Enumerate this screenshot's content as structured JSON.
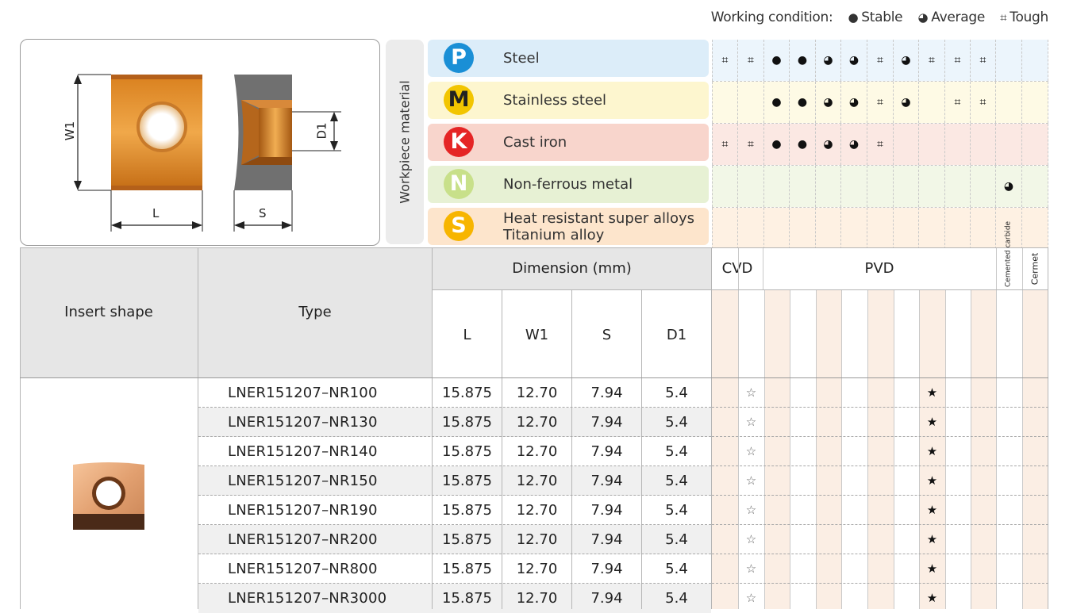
{
  "legend": {
    "label": "Working condition:",
    "items": [
      {
        "symbol": "●",
        "label": "Stable"
      },
      {
        "symbol": "◕",
        "label": "Average"
      },
      {
        "symbol": "⌗",
        "label": "Tough"
      }
    ]
  },
  "drawing": {
    "w1_label": "W1",
    "l_label": "L",
    "s_label": "S",
    "d1_label": "D1"
  },
  "workpiece_label": "Workpiece material",
  "materials": [
    {
      "letter": "P",
      "name": "Steel",
      "circle_color": "#1a8fd6",
      "bg": "#dcedf9",
      "conditions": [
        "⌗",
        "⌗",
        "●",
        "●",
        "◕",
        "◕",
        "⌗",
        "◕",
        "⌗",
        "⌗",
        "⌗",
        "",
        ""
      ]
    },
    {
      "letter": "M",
      "name": "Stainless steel",
      "circle_color": "#f2c500",
      "bg": "#fdf6cf",
      "conditions": [
        "",
        "",
        "●",
        "●",
        "◕",
        "◕",
        "⌗",
        "◕",
        "",
        "⌗",
        "⌗",
        "",
        ""
      ]
    },
    {
      "letter": "K",
      "name": "Cast iron",
      "circle_color": "#e52525",
      "bg": "#f8d5cc",
      "conditions": [
        "⌗",
        "⌗",
        "●",
        "●",
        "◕",
        "◕",
        "⌗",
        "",
        "",
        "",
        "",
        "",
        ""
      ]
    },
    {
      "letter": "N",
      "name": "Non-ferrous metal",
      "circle_color": "#c8e08a",
      "bg": "#e7f1d4",
      "conditions": [
        "",
        "",
        "",
        "",
        "",
        "",
        "",
        "",
        "",
        "",
        "",
        "◕",
        ""
      ]
    },
    {
      "letter": "S",
      "name": "Heat resistant super alloys\nTitanium alloy",
      "circle_color": "#f7b500",
      "bg": "#fde5cc",
      "conditions": [
        "",
        "",
        "",
        "",
        "",
        "",
        "",
        "",
        "",
        "",
        "",
        "",
        ""
      ]
    }
  ],
  "table": {
    "insert_shape_header": "Insert shape",
    "type_header": "Type",
    "dimension_header": "Dimension (mm)",
    "dim_columns": [
      "L",
      "W1",
      "S",
      "D1"
    ],
    "cvd_header": "CVD",
    "pvd_header": "PVD",
    "cemented_header": "Cemented carbide",
    "cermet_header": "Cermet",
    "rows": [
      {
        "type": "LNER151207–NR100",
        "L": "15.875",
        "W1": "12.70",
        "S": "7.94",
        "D1": "5.4",
        "cvd_star": "☆",
        "pvd_star": "★"
      },
      {
        "type": "LNER151207–NR130",
        "L": "15.875",
        "W1": "12.70",
        "S": "7.94",
        "D1": "5.4",
        "cvd_star": "☆",
        "pvd_star": "★"
      },
      {
        "type": "LNER151207–NR140",
        "L": "15.875",
        "W1": "12.70",
        "S": "7.94",
        "D1": "5.4",
        "cvd_star": "☆",
        "pvd_star": "★"
      },
      {
        "type": "LNER151207–NR150",
        "L": "15.875",
        "W1": "12.70",
        "S": "7.94",
        "D1": "5.4",
        "cvd_star": "☆",
        "pvd_star": "★"
      },
      {
        "type": "LNER151207–NR190",
        "L": "15.875",
        "W1": "12.70",
        "S": "7.94",
        "D1": "5.4",
        "cvd_star": "☆",
        "pvd_star": "★"
      },
      {
        "type": "LNER151207–NR200",
        "L": "15.875",
        "W1": "12.70",
        "S": "7.94",
        "D1": "5.4",
        "cvd_star": "☆",
        "pvd_star": "★"
      },
      {
        "type": "LNER151207–NR800",
        "L": "15.875",
        "W1": "12.70",
        "S": "7.94",
        "D1": "5.4",
        "cvd_star": "☆",
        "pvd_star": "★"
      },
      {
        "type": "LNER151207–NR3000",
        "L": "15.875",
        "W1": "12.70",
        "S": "7.94",
        "D1": "5.4",
        "cvd_star": "☆",
        "pvd_star": "★"
      }
    ]
  }
}
